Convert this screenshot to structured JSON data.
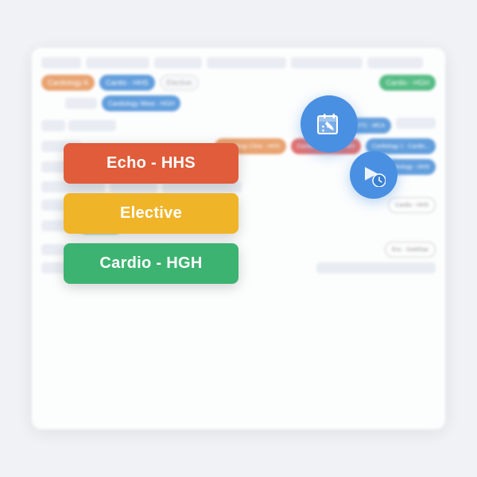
{
  "cards": [
    {
      "id": "echo-hhs",
      "label": "Echo - HHS",
      "colorClass": "card-red"
    },
    {
      "id": "elective",
      "label": "Elective",
      "colorClass": "card-yellow"
    },
    {
      "id": "cardio-hgh",
      "label": "Cardio - HGH",
      "colorClass": "card-green"
    }
  ],
  "icons": [
    {
      "id": "calendar-edit-icon",
      "type": "calendar"
    },
    {
      "id": "send-clock-icon",
      "type": "send"
    }
  ],
  "bg": {
    "rows": [
      {
        "cells": [
          50,
          80,
          60,
          100,
          90,
          70
        ]
      },
      {
        "cells": [
          60,
          90,
          80,
          110,
          85,
          65
        ]
      },
      {
        "cells": [
          55,
          75,
          95,
          80,
          70,
          90
        ]
      }
    ]
  }
}
